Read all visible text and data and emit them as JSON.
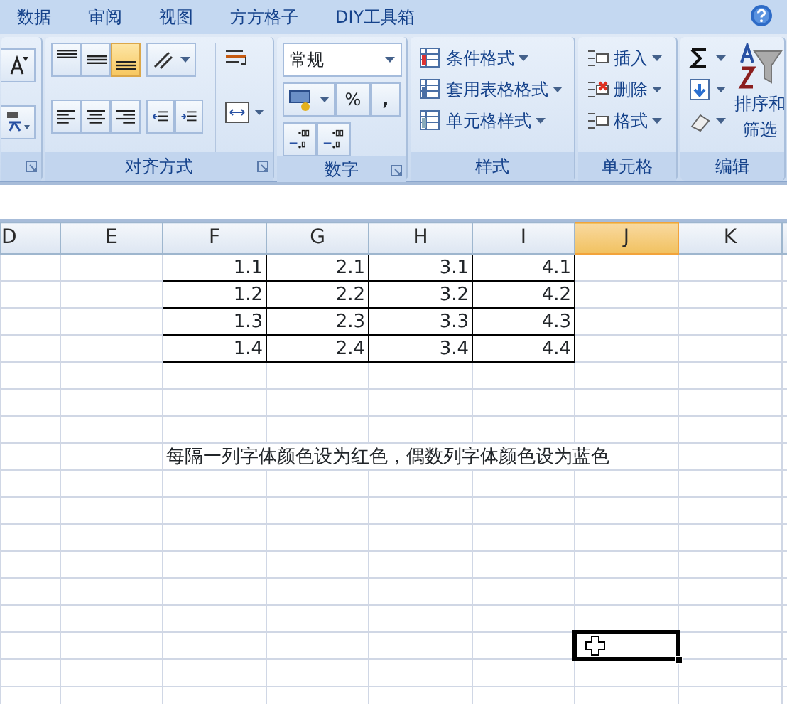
{
  "menu_tabs": [
    {
      "label": "数据"
    },
    {
      "label": "审阅"
    },
    {
      "label": "视图"
    },
    {
      "label": "方方格子"
    },
    {
      "label": "DIY工具箱"
    }
  ],
  "ribbon": {
    "groups": [
      {
        "kind": "font"
      },
      {
        "kind": "alignment",
        "label": "对齐方式",
        "vertical_align": [
          {
            "selected": false
          },
          {
            "selected": false
          },
          {
            "selected": true
          }
        ],
        "horizontal_align": [
          {
            "selected": false
          },
          {
            "selected": false
          },
          {
            "selected": false
          }
        ]
      },
      {
        "kind": "number",
        "label": "数字",
        "format": "常规",
        "percent": "%",
        "comma": ","
      },
      {
        "kind": "styles",
        "label": "样式",
        "items": [
          "条件格式",
          "套用表格格式",
          "单元格样式"
        ]
      },
      {
        "kind": "cells",
        "label": "单元格",
        "items": [
          "插入",
          "删除",
          "格式"
        ]
      },
      {
        "kind": "editing",
        "label": "编辑",
        "sort": "排序和",
        "filter": "筛选"
      }
    ]
  },
  "sheet": {
    "columns": [
      {
        "label": "D",
        "selected": false
      },
      {
        "label": "E",
        "selected": false
      },
      {
        "label": "F",
        "selected": false
      },
      {
        "label": "G",
        "selected": false
      },
      {
        "label": "H",
        "selected": false
      },
      {
        "label": "I",
        "selected": false
      },
      {
        "label": "J",
        "selected": true
      },
      {
        "label": "K",
        "selected": false
      }
    ],
    "rows": [
      {
        "values": [
          "1.1",
          "2.1",
          "3.1",
          "4.1"
        ],
        "active": false
      },
      {
        "values": [
          "1.2",
          "2.2",
          "3.2",
          "4.2"
        ],
        "active": false
      },
      {
        "values": [
          "1.3",
          "2.3",
          "3.3",
          "4.3"
        ],
        "active": false
      },
      {
        "values": [
          "1.4",
          "2.4",
          "3.4",
          "4.4"
        ],
        "active": false
      },
      {
        "active": false
      },
      {
        "active": false
      },
      {
        "active": false
      },
      {
        "note": "每隔一列字体颜色设为红色，偶数列字体颜色设为蓝色",
        "active": false
      },
      {
        "active": false
      },
      {
        "active": false
      },
      {
        "active": false
      },
      {
        "active": false
      },
      {
        "active": false
      },
      {
        "active": false
      },
      {
        "active": true
      },
      {
        "active": false
      },
      {
        "active": false
      }
    ]
  }
}
